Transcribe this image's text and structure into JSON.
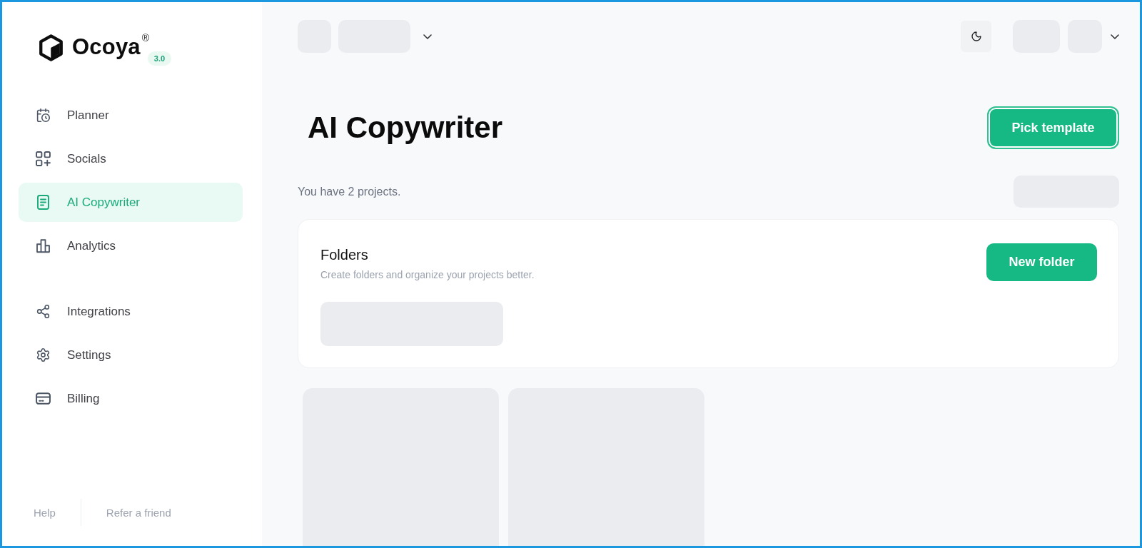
{
  "sidebar": {
    "logo": {
      "name": "Ocoya",
      "registered_mark": "®",
      "version": "3.0"
    },
    "nav_groups": [
      {
        "items": [
          {
            "label": "Planner",
            "selected": false
          },
          {
            "label": "Socials",
            "selected": false
          },
          {
            "label": "AI Copywriter",
            "selected": true
          },
          {
            "label": "Analytics",
            "selected": false
          }
        ]
      },
      {
        "items": [
          {
            "label": "Integrations",
            "selected": false
          },
          {
            "label": "Settings",
            "selected": false
          },
          {
            "label": "Billing",
            "selected": false
          }
        ]
      }
    ],
    "footer_links": [
      "Help",
      "Refer a friend"
    ]
  },
  "page": {
    "title": "AI Copywriter",
    "primary_button": "Pick template",
    "project_count": "You have 2 projects."
  },
  "folders_card": {
    "title": "Folders",
    "description": "Create folders and organize your projects better.",
    "button": "New folder"
  }
}
